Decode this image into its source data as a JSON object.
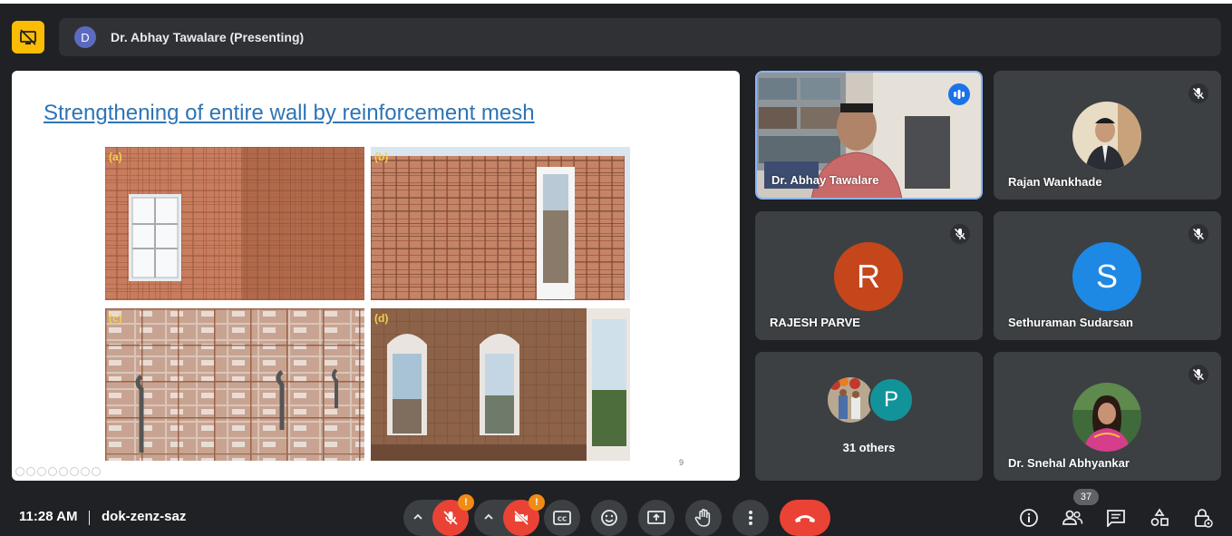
{
  "presenter": {
    "initial": "D",
    "name": "Dr. Abhay Tawalare (Presenting)"
  },
  "slide": {
    "title": "Strengthening of entire wall by reinforcement mesh",
    "photos": [
      {
        "label": "(a)"
      },
      {
        "label": "(b)"
      },
      {
        "label": "(c)"
      },
      {
        "label": "(d)"
      }
    ],
    "page_number": "9"
  },
  "participants": [
    {
      "name": "Dr. Abhay Tawalare",
      "type": "video",
      "speaking": true
    },
    {
      "name": "Rajan Wankhade",
      "type": "photo",
      "muted": true
    },
    {
      "name": "RAJESH PARVE",
      "type": "initial",
      "initial": "R",
      "color": "#c5461b",
      "muted": true
    },
    {
      "name": "Sethuraman Sudarsan",
      "type": "initial",
      "initial": "S",
      "color": "#1e88e5",
      "muted": true
    },
    {
      "name": "31 others",
      "type": "group",
      "initial": "P",
      "color": "#12939a"
    },
    {
      "name": "Dr. Snehal Abhyankar",
      "type": "photo",
      "muted": true
    }
  ],
  "footer": {
    "time": "11:28 AM",
    "meeting_code": "dok-zenz-saz",
    "mic_warning": "!",
    "cam_warning": "!",
    "people_count": "37"
  },
  "colors": {
    "accent": "#fbbc04",
    "end_call": "#ea4335",
    "speaking_border": "#8ab4f8"
  },
  "icons": [
    "present-off-icon",
    "chevron-up-icon",
    "mic-off-icon",
    "camera-off-icon",
    "captions-icon",
    "emoji-icon",
    "present-screen-icon",
    "raise-hand-icon",
    "more-vert-icon",
    "call-end-icon",
    "info-icon",
    "people-icon",
    "chat-icon",
    "activities-icon",
    "host-controls-icon"
  ]
}
